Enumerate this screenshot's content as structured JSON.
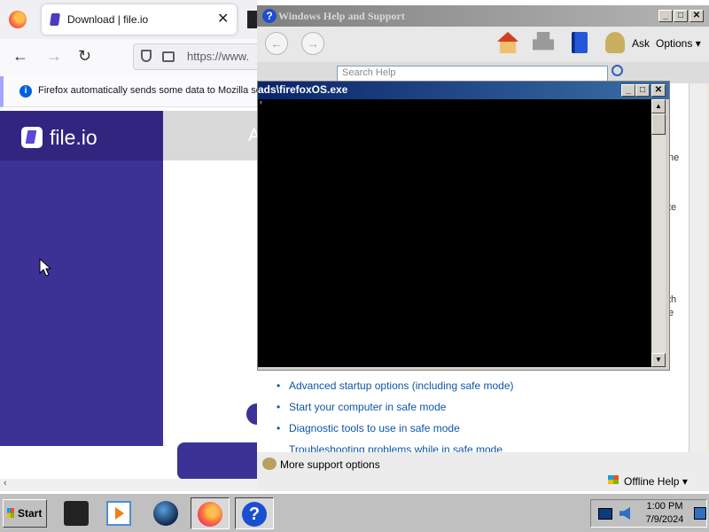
{
  "firefox": {
    "tab": {
      "title": "Download | file.io",
      "close": "✕"
    },
    "nav": {
      "back": "←",
      "forward": "→",
      "reload": "↻"
    },
    "url": "https://www.",
    "notification": {
      "info": "i",
      "text": "Firefox automatically sends some data to Mozilla so"
    },
    "site": {
      "logo_text": "file.io",
      "main_heading_partial": "A"
    },
    "scroll_left": "‹"
  },
  "help_window": {
    "title": "Windows Help and Support",
    "title_icon": "?",
    "caption_buttons": {
      "minimize": "_",
      "maximize": "□",
      "close": "✕"
    },
    "toolbar": {
      "back": "←",
      "forward": "→",
      "ask_label": "Ask",
      "options_label": "Options ▾"
    },
    "search_placeholder": "Search Help",
    "links": [
      "Advanced startup options (including safe mode)",
      "Start your computer in safe mode",
      "Diagnostic tools to use in safe mode",
      "Troubleshooting problems while in safe mode"
    ],
    "edge_fragments": [
      "ne",
      "te",
      "th",
      "e"
    ],
    "more_support": "More support options",
    "offline_help": "Offline Help ▾"
  },
  "console_window": {
    "title": "ads\\firefoxOS.exe",
    "cursor_text": "'",
    "caption_buttons": {
      "minimize": "_",
      "maximize": "□",
      "close": "✕"
    },
    "scroll_up": "▲",
    "scroll_down": "▼"
  },
  "taskbar": {
    "start_label": "Start",
    "clock_time": "1:00 PM",
    "clock_date": "7/9/2024"
  },
  "icons": {
    "firefox": "firefox-icon",
    "help": "help-icon",
    "printer": "printer-icon",
    "media": "media-player-icon",
    "globe": "globe-icon"
  },
  "colors": {
    "fileio_brand": "#3c3296",
    "console_title": "#0a246a",
    "help_link": "#0d56a6"
  }
}
